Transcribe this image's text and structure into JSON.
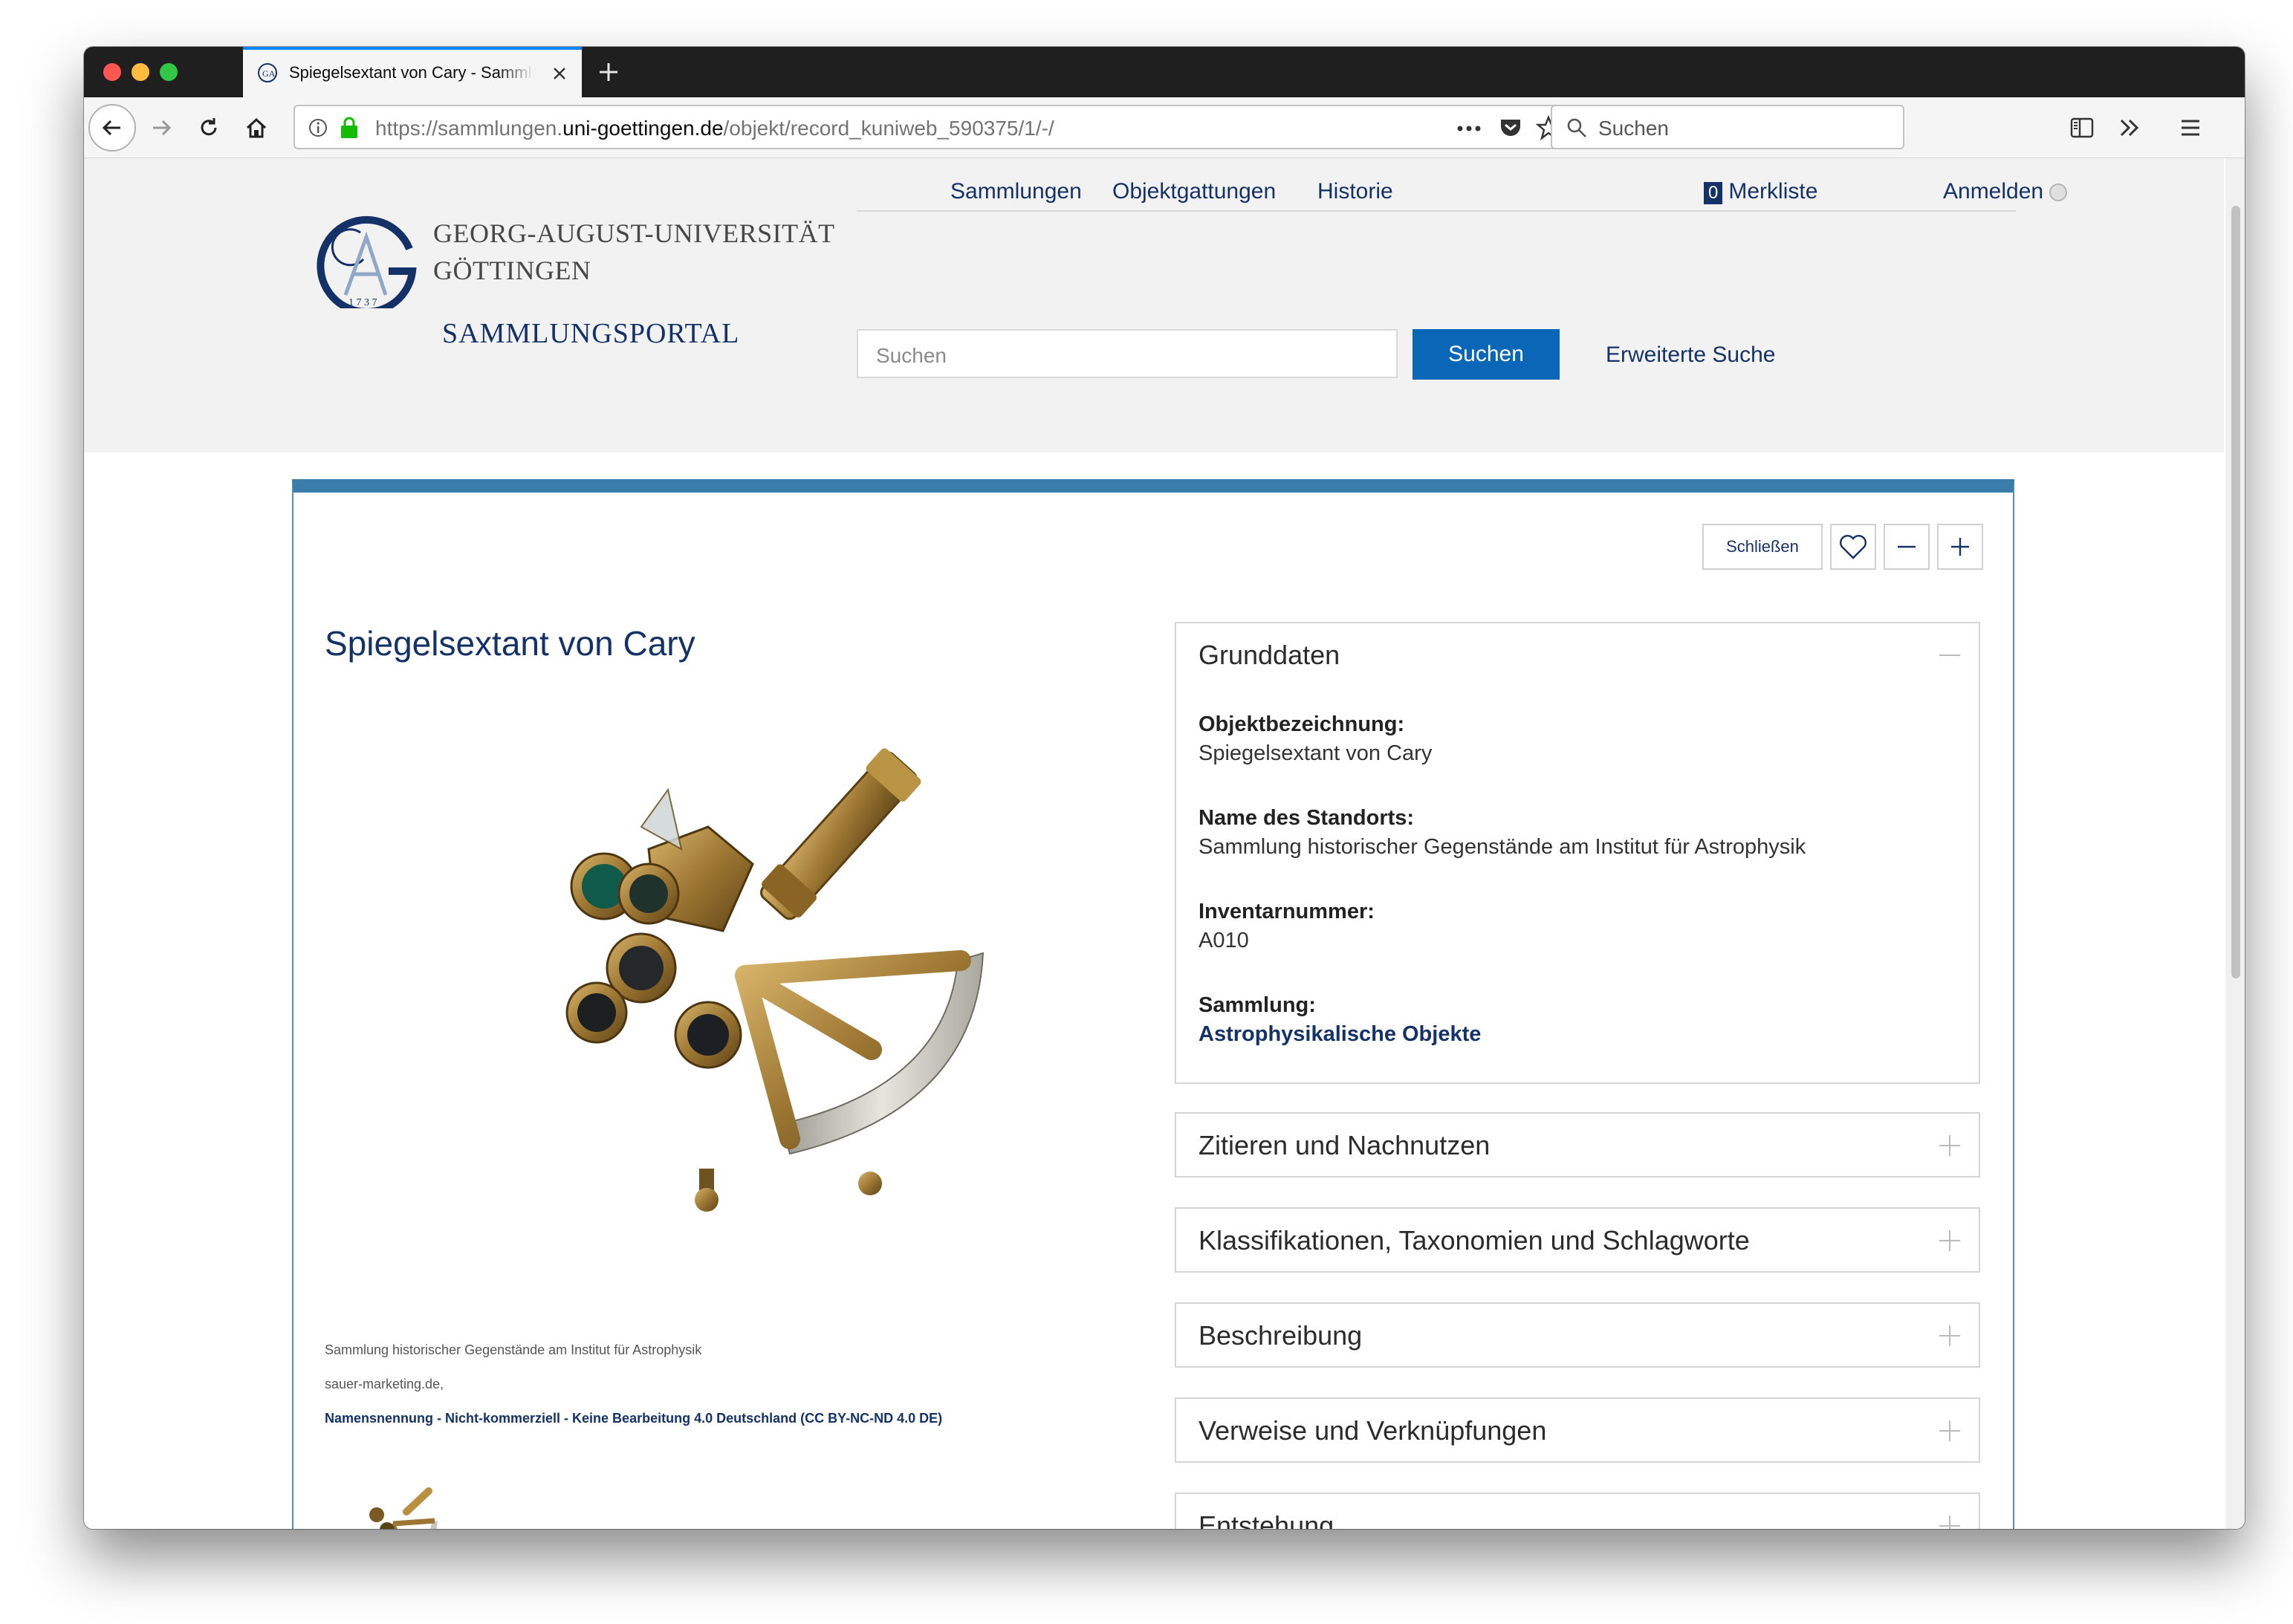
{
  "browser": {
    "tab_title": "Spiegelsextant von Cary - Sammlungsportal",
    "url_prefix": "https://sammlungen.",
    "url_domain": "uni-goettingen.de",
    "url_path": "/objekt/record_kuniweb_590375/1/-/",
    "search_placeholder": "Suchen"
  },
  "site": {
    "uni_name_line1": "GEORG-AUGUST-UNIVERSITÄT",
    "uni_name_line2": "GÖTTINGEN",
    "portal_name": "SAMMLUNGSPORTAL",
    "nav": {
      "sammlungen": "Sammlungen",
      "objektgattungen": "Objektgattungen",
      "historie": "Historie",
      "merkliste_count": "0",
      "merkliste": "Merkliste",
      "anmelden": "Anmelden"
    },
    "search_placeholder": "Suchen",
    "search_button": "Suchen",
    "advanced_search": "Erweiterte Suche"
  },
  "object": {
    "close_label": "Schließen",
    "title": "Spiegelsextant von Cary",
    "credit_holder": "Sammlung historischer Gegenstände am Institut für Astrophysik",
    "credit_photo": "sauer-marketing.de,",
    "license": "Namensnennung - Nicht-kommerziell - Keine Bearbeitung 4.0 Deutschland (CC BY-NC-ND 4.0 DE)"
  },
  "grunddaten": {
    "heading": "Grunddaten",
    "fields": [
      {
        "label": "Objektbezeichnung:",
        "value": "Spiegelsextant von Cary"
      },
      {
        "label": "Name des Standorts:",
        "value": "Sammlung historischer Gegenstände am Institut für Astrophysik"
      },
      {
        "label": "Inventarnummer:",
        "value": "A010"
      },
      {
        "label": "Sammlung:",
        "value": "Astrophysikalische Objekte"
      }
    ]
  },
  "sections": [
    "Zitieren und Nachnutzen",
    "Klassifikationen, Taxonomien und Schlagworte",
    "Beschreibung",
    "Verweise und Verknüpfungen",
    "Entstehung"
  ],
  "colors": {
    "brand": "#153268",
    "accent_blue": "#0a66b7",
    "panel_top": "#3a7dab"
  },
  "icons": [
    "back-arrow-icon",
    "forward-arrow-icon",
    "reload-icon",
    "home-icon",
    "info-icon",
    "lock-icon",
    "page-actions-icon",
    "pocket-icon",
    "bookmark-star-icon",
    "search-icon",
    "sidebar-icon",
    "overflow-icon",
    "hamburger-menu-icon",
    "heart-icon",
    "minus-icon",
    "plus-icon"
  ]
}
